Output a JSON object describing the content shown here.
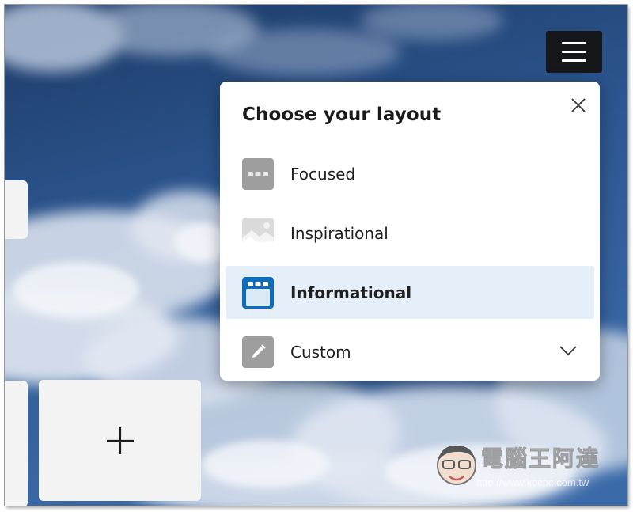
{
  "panel": {
    "title": "Choose your layout",
    "options": [
      {
        "label": "Focused",
        "icon": "focused-layout-icon",
        "selected": false
      },
      {
        "label": "Inspirational",
        "icon": "inspirational-layout-icon",
        "selected": false
      },
      {
        "label": "Informational",
        "icon": "informational-layout-icon",
        "selected": true
      },
      {
        "label": "Custom",
        "icon": "pencil-icon",
        "selected": false
      }
    ]
  },
  "watermark": {
    "text": "電腦王阿達",
    "url": "http://www.kocpc.com.tw"
  },
  "colors": {
    "accent": "#0f6cbd",
    "selected_bg": "#e5eff9",
    "menu_button": "#15171a",
    "icon_gray": "#9e9e9e"
  }
}
